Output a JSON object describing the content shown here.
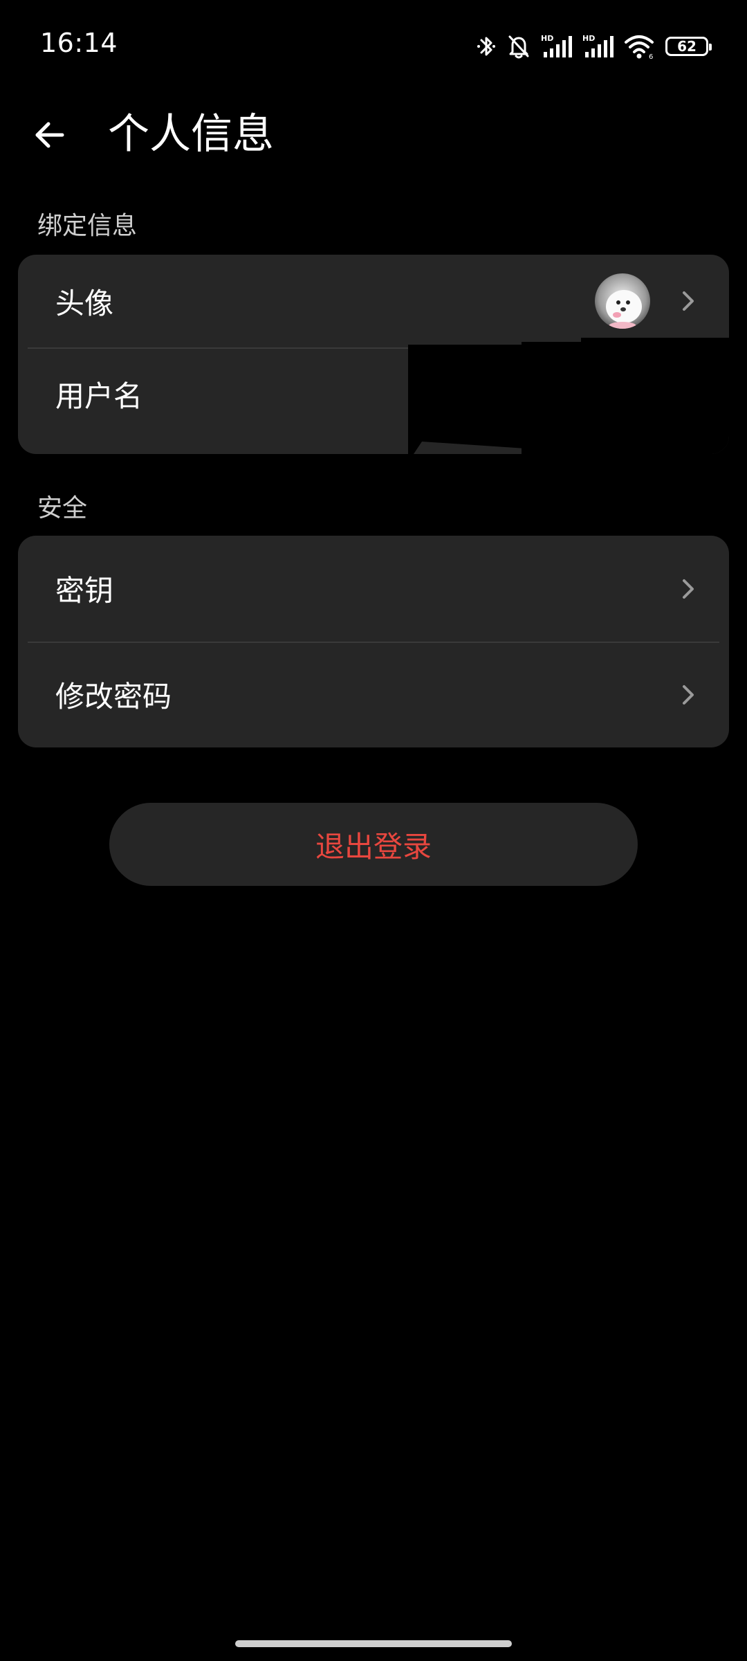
{
  "status_bar": {
    "time": "16:14",
    "icons": [
      "bluetooth-icon",
      "silent-bell-icon",
      "signal-hd-icon",
      "signal-hd-icon",
      "wifi-icon",
      "battery-icon"
    ],
    "signal_tag": "HD",
    "battery_level": "62"
  },
  "header": {
    "back_icon": "arrow-left-icon",
    "title": "个人信息"
  },
  "sections": {
    "binding": {
      "label": "绑定信息",
      "rows": [
        {
          "label": "头像",
          "trailing": "avatar-image"
        },
        {
          "label": "用户名",
          "trailing": "redacted"
        }
      ]
    },
    "security": {
      "label": "安全",
      "rows": [
        {
          "label": "密钥",
          "trailing": "chevron-right-icon"
        },
        {
          "label": "修改密码",
          "trailing": "chevron-right-icon"
        }
      ]
    }
  },
  "logout": {
    "label": "退出登录"
  },
  "colors": {
    "background": "#000000",
    "card": "#262626",
    "logout_text": "#e8473f",
    "divider": "#3a3a3a"
  }
}
